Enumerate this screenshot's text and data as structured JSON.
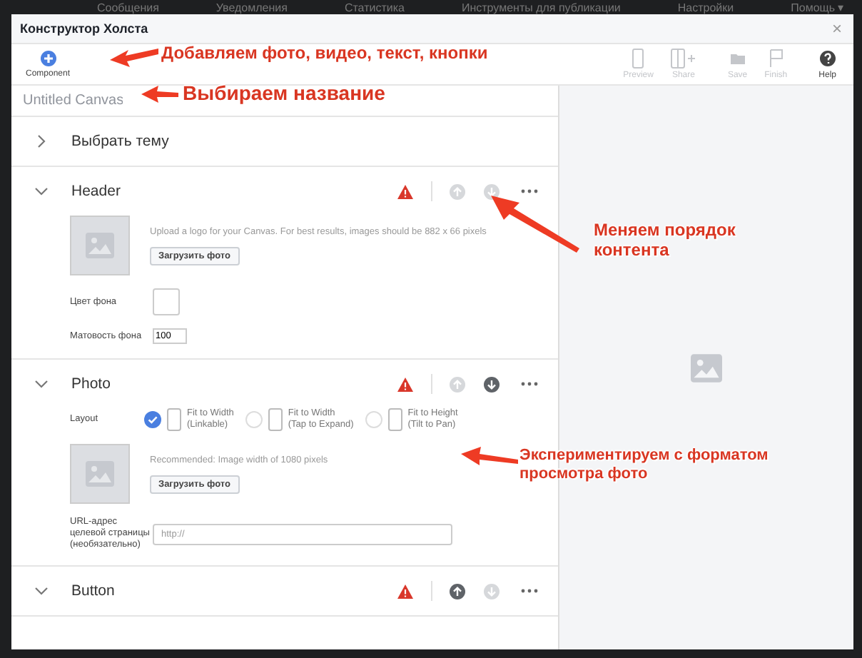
{
  "background_nav": [
    "Сообщения",
    "Уведомления",
    "Статистика",
    "Инструменты для публикации",
    "Настройки",
    "Помощь ▾"
  ],
  "window": {
    "title": "Конструктор Холста",
    "close": "×"
  },
  "toolbar": {
    "component": {
      "label": "Component"
    },
    "tools": [
      {
        "kind": "preview",
        "label": "Preview",
        "disabled": true
      },
      {
        "kind": "share",
        "label": "Share",
        "disabled": true
      },
      {
        "kind": "save",
        "label": "Save",
        "disabled": true
      },
      {
        "kind": "finish",
        "label": "Finish",
        "disabled": true
      },
      {
        "kind": "help",
        "label": "Help",
        "disabled": false
      }
    ]
  },
  "canvas_name": {
    "placeholder": "Untitled Canvas"
  },
  "sections": [
    {
      "kind": "theme",
      "title": "Выбрать тему",
      "expanded": false
    },
    {
      "kind": "header",
      "title": "Header",
      "expanded": true,
      "warning": true,
      "up_enabled": false,
      "down_enabled": false,
      "hint": "Upload a logo for your Canvas. For best results, images should be 882 x 66 pixels",
      "upload_button": "Загрузить фото",
      "fields": [
        {
          "kind": "color",
          "label": "Цвет фона"
        },
        {
          "kind": "number",
          "label": "Матовость фона",
          "value": "100"
        }
      ]
    },
    {
      "kind": "photo",
      "title": "Photo",
      "expanded": true,
      "warning": true,
      "up_enabled": false,
      "down_enabled": true,
      "layout_label": "Layout",
      "layout_options": [
        {
          "title": "Fit to Width",
          "subtitle": "(Linkable)",
          "selected": true
        },
        {
          "title": "Fit to Width",
          "subtitle": "(Tap to Expand)",
          "selected": false
        },
        {
          "title": "Fit to Height",
          "subtitle": "(Tilt to Pan)",
          "selected": false
        }
      ],
      "hint": "Recommended: Image width of 1080 pixels",
      "upload_button": "Загрузить фото",
      "fields": [
        {
          "kind": "url",
          "label": "URL-адрес целевой страницы (необязательно)",
          "placeholder": "http://"
        }
      ]
    },
    {
      "kind": "button",
      "title": "Button",
      "expanded": true,
      "warning": true,
      "up_enabled": true,
      "down_enabled": false
    }
  ],
  "annotations": [
    "Добавляем фото, видео, текст, кнопки",
    "Выбираем название",
    "Меняем порядок контента",
    "Экспериментируем с форматом просмотра фото"
  ]
}
